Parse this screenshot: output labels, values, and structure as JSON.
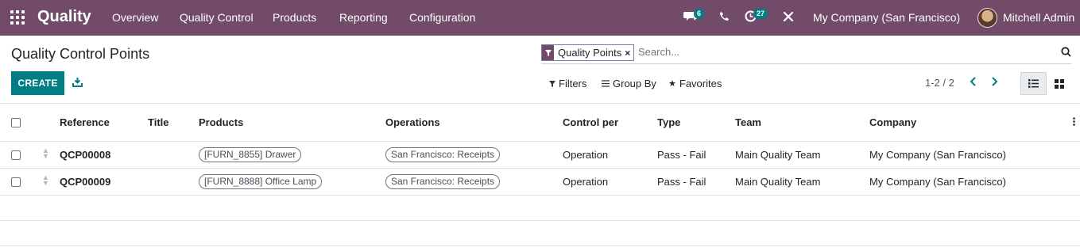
{
  "app": {
    "name": "Quality"
  },
  "nav": {
    "menus": [
      "Overview",
      "Quality Control",
      "Products",
      "Reporting",
      "Configuration"
    ],
    "messages_count": "6",
    "activities_count": "27",
    "company": "My Company (San Francisco)",
    "user": "Mitchell Admin"
  },
  "control_panel": {
    "title": "Quality Control Points",
    "create_label": "CREATE",
    "facet_label": "Quality Points",
    "search_placeholder": "Search...",
    "filters_label": "Filters",
    "groupby_label": "Group By",
    "favorites_label": "Favorites",
    "pager": "1-2 / 2"
  },
  "table": {
    "headers": [
      "Reference",
      "Title",
      "Products",
      "Operations",
      "Control per",
      "Type",
      "Team",
      "Company"
    ],
    "rows": [
      {
        "reference": "QCP00008",
        "title": "",
        "product": "[FURN_8855] Drawer",
        "operation": "San Francisco: Receipts",
        "control_per": "Operation",
        "type": "Pass - Fail",
        "team": "Main Quality Team",
        "company": "My Company (San Francisco)"
      },
      {
        "reference": "QCP00009",
        "title": "",
        "product": "[FURN_8888] Office Lamp",
        "operation": "San Francisco: Receipts",
        "control_per": "Operation",
        "type": "Pass - Fail",
        "team": "Main Quality Team",
        "company": "My Company (San Francisco)"
      }
    ]
  },
  "colors": {
    "brand": "#714B67",
    "primary": "#017E84"
  },
  "icons": [
    "apps-icon",
    "chat-icon",
    "phone-icon",
    "activity-icon",
    "tools-icon",
    "download-icon",
    "filter-icon",
    "search-icon",
    "list-view-icon",
    "kanban-view-icon"
  ]
}
